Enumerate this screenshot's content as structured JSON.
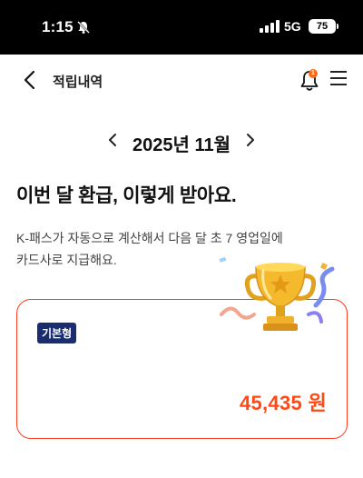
{
  "status_bar": {
    "time": "1:15",
    "network": "5G",
    "battery": "75"
  },
  "header": {
    "title": "적립내역",
    "notification_count": "1"
  },
  "month_nav": {
    "label": "2025년 11월"
  },
  "headline": "이번 달 환급, 이렇게 받아요.",
  "description_line1": "K-패스가 자동으로 계산해서 다음 달 초 7 영업일에",
  "description_line2": "카드사로 지급해요.",
  "card": {
    "badge": "기본형",
    "amount": "45,435 원"
  },
  "colors": {
    "accent": "#ff4a14",
    "card_border": "#ff3b1f",
    "badge_bg": "#1a2d6e",
    "notification_dot": "#ff6a1a"
  },
  "icons": [
    "bell-off-icon",
    "signal-icon",
    "back-arrow-icon",
    "bell-icon",
    "menu-icon",
    "chevron-left-icon",
    "chevron-right-icon",
    "trophy-icon"
  ]
}
